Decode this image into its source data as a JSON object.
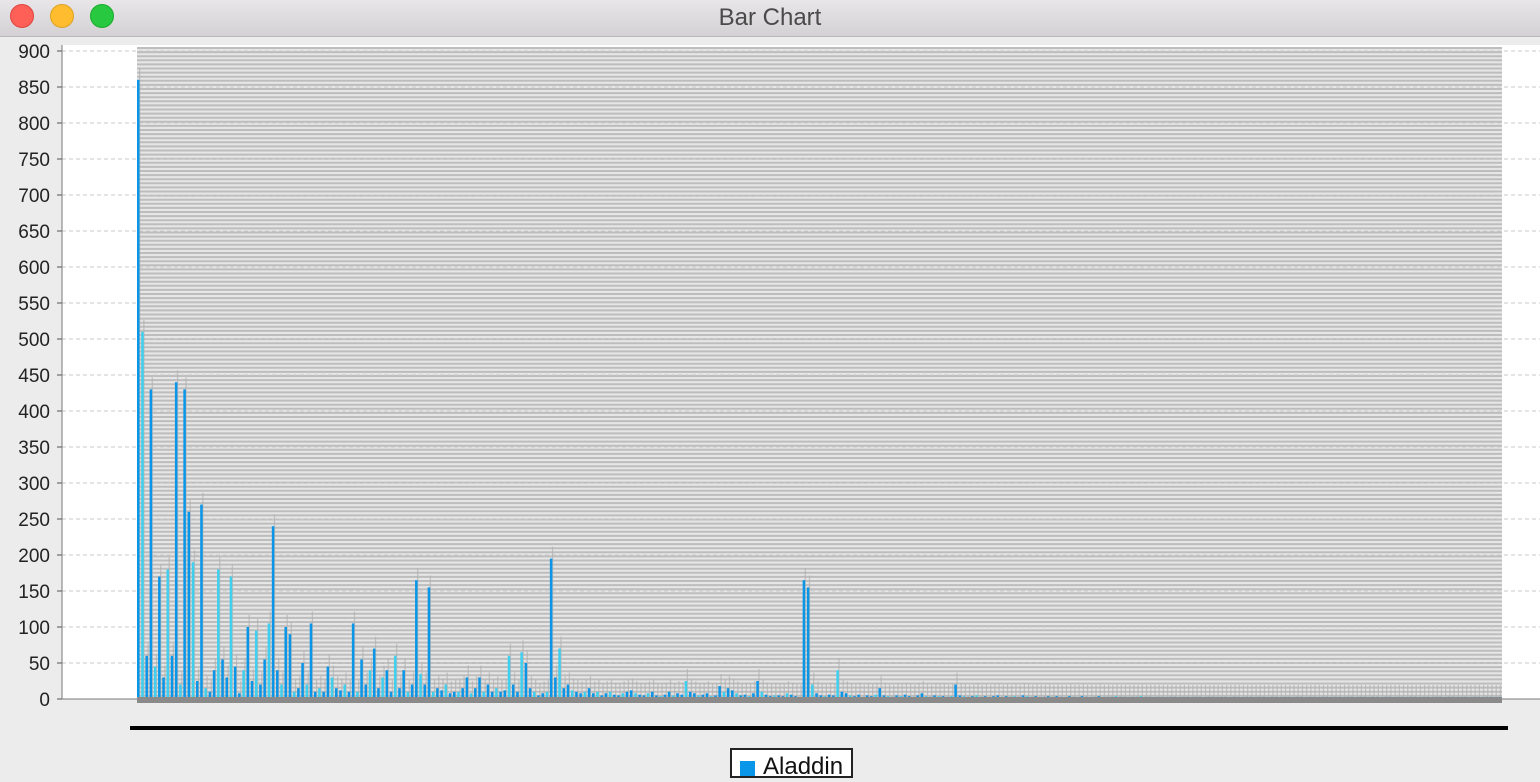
{
  "window": {
    "title": "Bar Chart"
  },
  "chart_data": {
    "type": "bar",
    "title": "",
    "xlabel": "",
    "ylabel": "",
    "ylim": [
      0,
      900
    ],
    "yticks": [
      0,
      50,
      100,
      150,
      200,
      250,
      300,
      350,
      400,
      450,
      500,
      550,
      600,
      650,
      700,
      750,
      800,
      850,
      900
    ],
    "grid": true,
    "legend_position": "bottom-center",
    "colors": {
      "series": "#0a96e8",
      "series_light": "#3fd0f0",
      "shadow": "#b0b0b0",
      "grid": "#c9c9c9"
    },
    "series": [
      {
        "name": "Aladdin",
        "values": [
          860,
          510,
          60,
          430,
          45,
          170,
          30,
          180,
          60,
          440,
          20,
          430,
          260,
          190,
          25,
          270,
          15,
          10,
          40,
          180,
          55,
          30,
          170,
          45,
          8,
          40,
          100,
          25,
          95,
          20,
          55,
          105,
          240,
          40,
          20,
          100,
          90,
          10,
          15,
          50,
          20,
          105,
          10,
          15,
          10,
          45,
          30,
          15,
          12,
          20,
          10,
          105,
          10,
          55,
          20,
          40,
          70,
          15,
          30,
          40,
          10,
          60,
          15,
          40,
          10,
          20,
          165,
          35,
          20,
          155,
          10,
          15,
          12,
          20,
          8,
          10,
          10,
          15,
          30,
          8,
          15,
          30,
          10,
          20,
          10,
          15,
          10,
          12,
          60,
          20,
          10,
          65,
          50,
          15,
          10,
          5,
          8,
          10,
          195,
          30,
          70,
          15,
          20,
          12,
          10,
          8,
          10,
          15,
          8,
          10,
          5,
          8,
          10,
          6,
          5,
          8,
          10,
          12,
          8,
          6,
          5,
          8,
          10,
          5,
          4,
          6,
          10,
          5,
          8,
          6,
          25,
          10,
          8,
          5,
          6,
          8,
          4,
          5,
          18,
          10,
          15,
          12,
          8,
          5,
          6,
          4,
          8,
          25,
          10,
          6,
          4,
          5,
          5,
          4,
          8,
          6,
          4,
          3,
          165,
          155,
          20,
          8,
          5,
          4,
          6,
          5,
          40,
          10,
          8,
          5,
          4,
          6,
          3,
          5,
          4,
          6,
          15,
          5,
          4,
          3,
          5,
          4,
          6,
          4,
          3,
          5,
          8,
          4,
          3,
          5,
          4,
          4,
          3,
          4,
          20,
          5,
          4,
          3,
          4,
          5,
          3,
          4,
          3,
          4,
          5,
          3,
          4,
          3,
          4,
          3,
          5,
          4,
          3,
          4,
          3,
          3,
          4,
          3,
          4,
          3,
          3,
          4,
          3,
          3,
          4,
          3,
          3,
          3,
          4,
          3,
          3,
          3,
          4,
          3,
          3,
          3,
          3,
          3,
          4,
          3,
          3,
          3,
          3,
          3,
          3,
          3,
          3,
          3,
          3,
          3,
          3,
          3,
          3,
          3,
          3,
          3,
          3,
          3,
          3,
          3,
          3,
          3,
          3,
          3,
          3,
          3,
          3,
          3,
          3,
          3,
          3,
          3,
          3,
          3,
          3,
          3,
          3,
          3,
          3,
          3,
          3,
          3,
          3,
          3,
          3,
          3,
          3,
          3,
          3,
          3,
          3,
          3,
          3,
          3,
          3,
          3,
          3,
          3,
          3,
          3,
          3,
          3,
          3,
          3,
          3,
          3,
          3,
          3,
          3,
          3,
          3,
          3,
          3,
          3,
          3,
          3,
          3,
          3,
          3,
          3,
          3,
          3,
          3,
          3
        ]
      }
    ]
  }
}
